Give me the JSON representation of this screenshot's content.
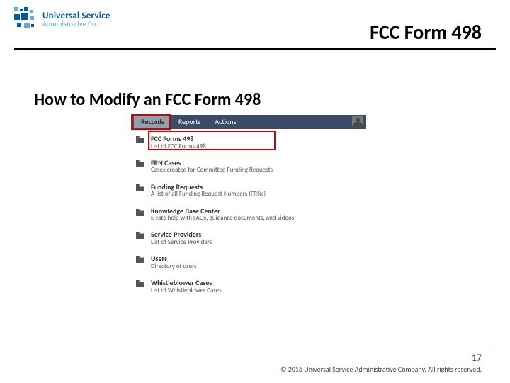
{
  "header": {
    "logo_line1": "Universal Service",
    "logo_line2": "Administrative Co.",
    "title": "FCC Form 498"
  },
  "subtitle": "How to Modify an FCC Form 498",
  "navbar": {
    "tabs": [
      {
        "label": "Records",
        "active": true
      },
      {
        "label": "Reports",
        "active": false
      },
      {
        "label": "Actions",
        "active": false
      }
    ]
  },
  "records": [
    {
      "title": "FCC Forms 498",
      "desc": "List of FCC Forms 498",
      "highlighted": true
    },
    {
      "title": "FRN Cases",
      "desc": "Cases created for Committed Funding Requests",
      "highlighted": false
    },
    {
      "title": "Funding Requests",
      "desc": "A list of all Funding Request Numbers (FRNs)",
      "highlighted": false
    },
    {
      "title": "Knowledge Base Center",
      "desc": "E-rate help with FAQs, guidance documents, and videos",
      "highlighted": false
    },
    {
      "title": "Service Providers",
      "desc": "List of Service Providers",
      "highlighted": false
    },
    {
      "title": "Users",
      "desc": "Directory of users",
      "highlighted": false
    },
    {
      "title": "Whistleblower Cases",
      "desc": "List of Whistleblower Cases",
      "highlighted": false
    }
  ],
  "footer": {
    "page_number": "17",
    "copyright": "© 2016 Universal Service Administrative Company. All rights reserved."
  }
}
